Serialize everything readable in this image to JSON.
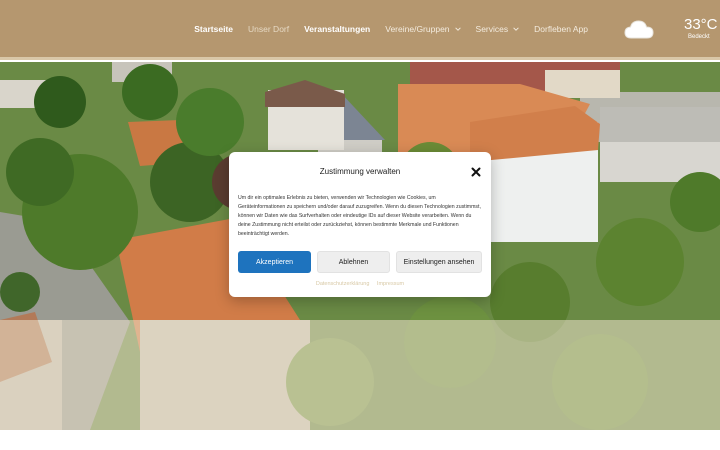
{
  "nav": {
    "items": [
      {
        "label": "Startseite",
        "state": "active"
      },
      {
        "label": "Unser Dorf",
        "state": "muted"
      },
      {
        "label": "Veranstaltungen",
        "state": "bold"
      },
      {
        "label": "Vereine/Gruppen",
        "state": "normal",
        "dropdown": true
      },
      {
        "label": "Services",
        "state": "normal",
        "dropdown": true
      },
      {
        "label": "Dorfleben App",
        "state": "normal"
      }
    ]
  },
  "weather": {
    "icon": "cloud-icon",
    "temperature": "33°C",
    "condition": "Bedeckt"
  },
  "consent": {
    "title": "Zustimmung verwalten",
    "text": "Um dir ein optimales Erlebnis zu bieten, verwenden wir Technologien wie Cookies, um Geräteinformationen zu speichern und/oder darauf zuzugreifen. Wenn du diesen Technologien zustimmst, können wir Daten wie das Surfverhalten oder eindeutige IDs auf dieser Website verarbeiten. Wenn du deine Zustimmung nicht erteilst oder zurückziehst, können bestimmte Merkmale und Funktionen beeinträchtigt werden.",
    "accept_label": "Akzeptieren",
    "deny_label": "Ablehnen",
    "settings_label": "Einstellungen ansehen",
    "privacy_link": "Datenschutzerklärung",
    "imprint_link": "Impressum"
  },
  "colors": {
    "header": "#b5976f",
    "accent": "#1e73be",
    "link": "#d8c9a6"
  }
}
